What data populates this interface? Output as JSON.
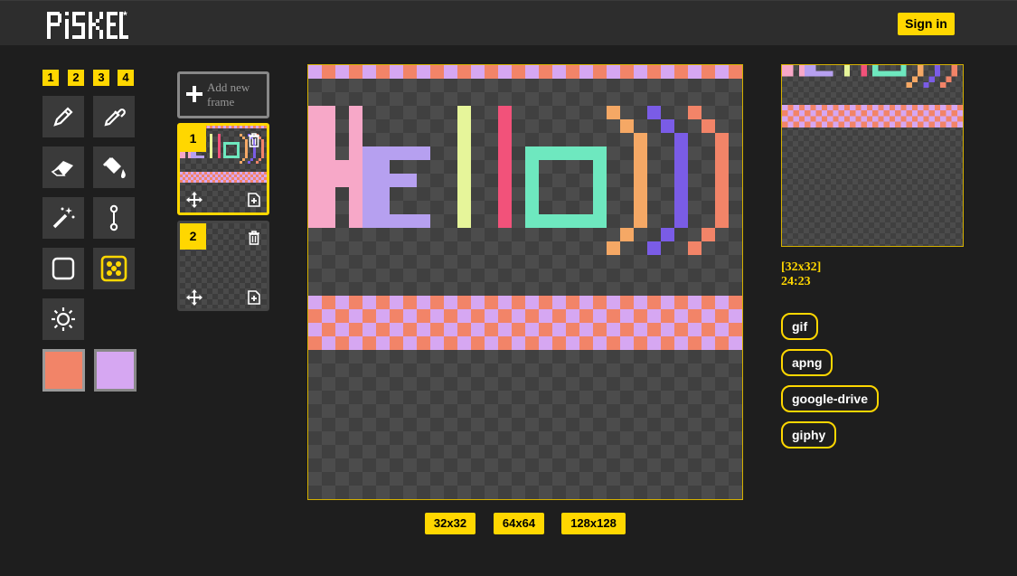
{
  "app": {
    "logo_text": "PiSKEL*"
  },
  "header": {
    "signin_label": "Sign in"
  },
  "palette_tabs": [
    "1",
    "2",
    "3",
    "4"
  ],
  "tools": [
    {
      "name": "pen-icon"
    },
    {
      "name": "eyedropper-icon"
    },
    {
      "name": "eraser-icon"
    },
    {
      "name": "paint-bucket-icon"
    },
    {
      "name": "magic-wand-icon"
    },
    {
      "name": "stroke-line-icon"
    },
    {
      "name": "rectangle-icon"
    },
    {
      "name": "dither-icon",
      "active": true
    },
    {
      "name": "lighten-icon"
    }
  ],
  "colors": {
    "primary": "#f28468",
    "secondary": "#d6a7f2",
    "accent": "#ffd700"
  },
  "frames_panel": {
    "add_label": "Add new frame",
    "frames": [
      {
        "number": "1",
        "selected": true
      },
      {
        "number": "2",
        "selected": false
      }
    ]
  },
  "canvas": {
    "text": "Hello))",
    "letter_colors": [
      "#f7a8c8",
      "#b6a0f0",
      "#e6f59a",
      "#f2527a",
      "#6ee8bf",
      "#f5a865",
      "#7a5ce6",
      "#f28468"
    ],
    "stripe_colors": [
      "#f28468",
      "#d6a7f2"
    ]
  },
  "info": {
    "dimensions": "[32x32]",
    "cursor": "24:23"
  },
  "export_buttons": [
    "gif",
    "apng",
    "google-drive",
    "giphy"
  ],
  "size_buttons": [
    "32x32",
    "64x64",
    "128x128"
  ]
}
